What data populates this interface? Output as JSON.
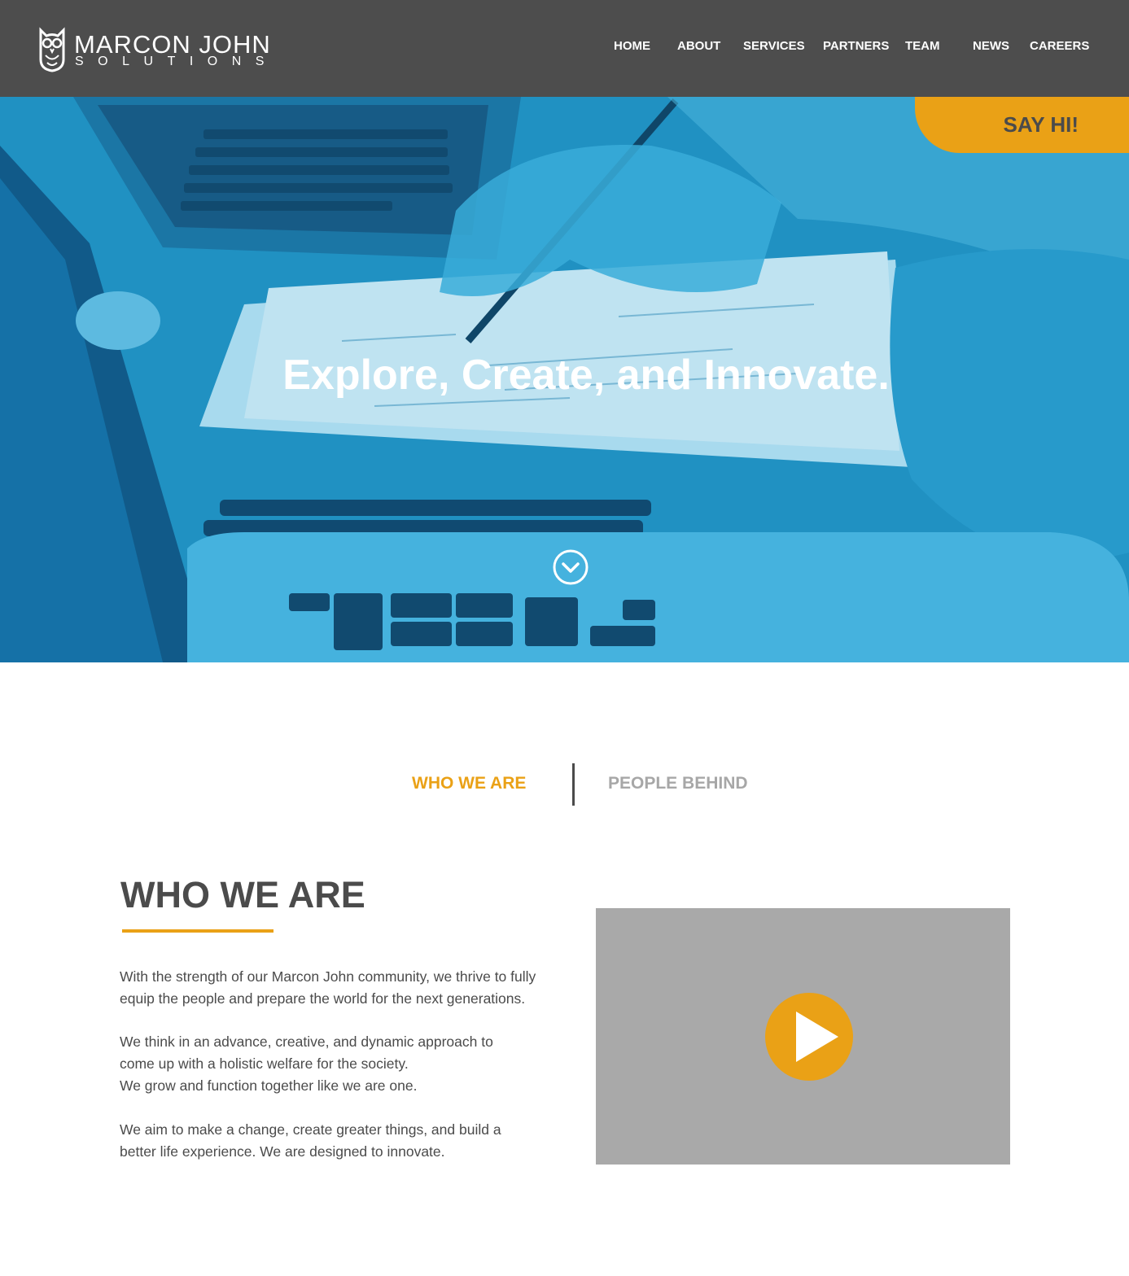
{
  "header": {
    "logo_name": "MARCON JOHN",
    "logo_sub": "SOLUTIONS",
    "logo_icon": "owl-icon",
    "nav": [
      {
        "label": "HOME"
      },
      {
        "label": "ABOUT"
      },
      {
        "label": "SERVICES"
      },
      {
        "label": "PARTNERS"
      },
      {
        "label": "TEAM"
      },
      {
        "label": "NEWS"
      },
      {
        "label": "CAREERS"
      }
    ]
  },
  "hero": {
    "cta": "SAY HI!",
    "title": "Explore, Create, and Innovate.",
    "scroll_icon": "chevron-down-circle-icon"
  },
  "tabs": {
    "active": "WHO WE ARE",
    "inactive": "PEOPLE BEHIND"
  },
  "content": {
    "title": "WHO WE ARE",
    "paragraphs": [
      [
        "With the strength of our Marcon John community, we thrive to fully",
        "equip the people and prepare the world for the next generations."
      ],
      [
        "We think in an advance, creative, and dynamic approach to",
        "come up with a holistic welfare for the society.",
        "We grow and function together like we are one."
      ],
      [
        "We aim to make a change, create greater things, and build a",
        "better life experience.  We are designed to innovate."
      ]
    ],
    "video_icon": "play-icon"
  },
  "colors": {
    "header_bg": "#4d4d4d",
    "accent": "#eaa116",
    "hero_blue": "#1e95c6",
    "text_dark": "#4b4b4b",
    "text_muted": "#a7a7a7",
    "video_placeholder": "#a9a9a9"
  }
}
